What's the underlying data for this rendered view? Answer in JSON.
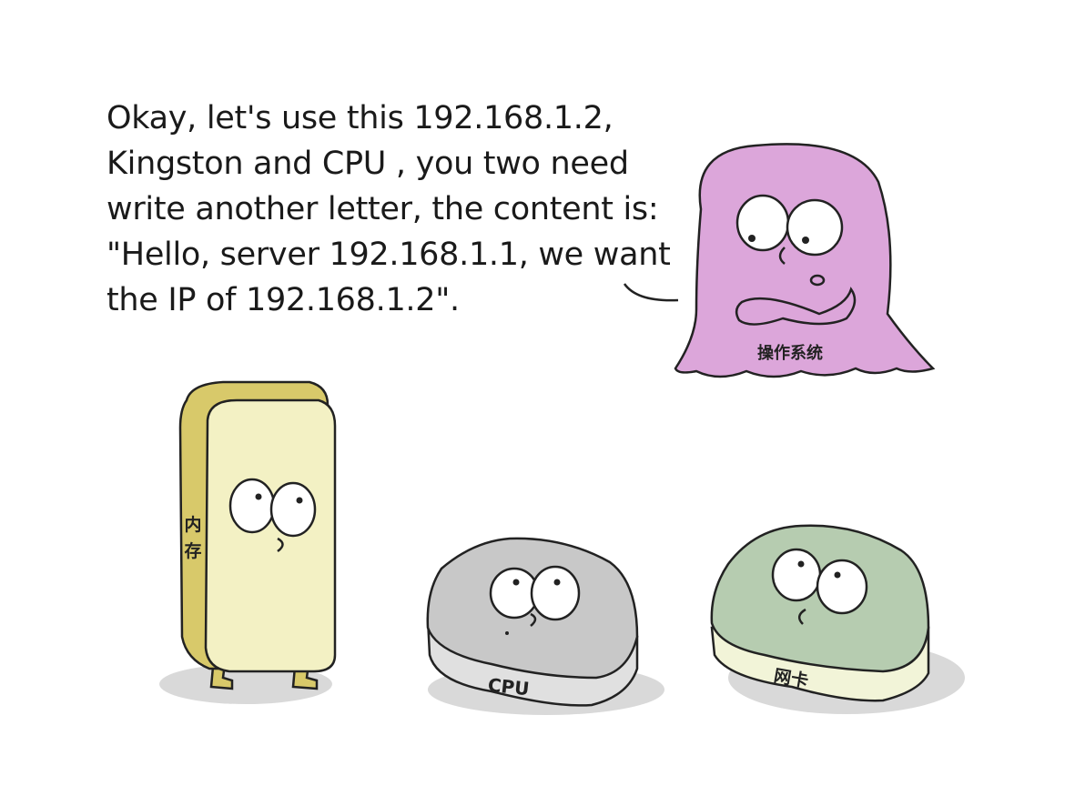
{
  "speech": {
    "lines": [
      "Okay, let's use this 192.168.1.2,",
      "Kingston and CPU , you two need",
      "write another letter, the content is:",
      "\"Hello, server 192.168.1.1, we want",
      "the IP of 192.168.1.2\"."
    ]
  },
  "characters": {
    "os": {
      "label": "操作系统",
      "color": "#dca6da"
    },
    "memory": {
      "label_top": "内",
      "label_bottom": "存",
      "color": "#f3f1c4"
    },
    "cpu": {
      "label": "CPU",
      "color": "#c8c8c8"
    },
    "nic": {
      "label": "网卡",
      "color": "#b6ccb0"
    }
  }
}
